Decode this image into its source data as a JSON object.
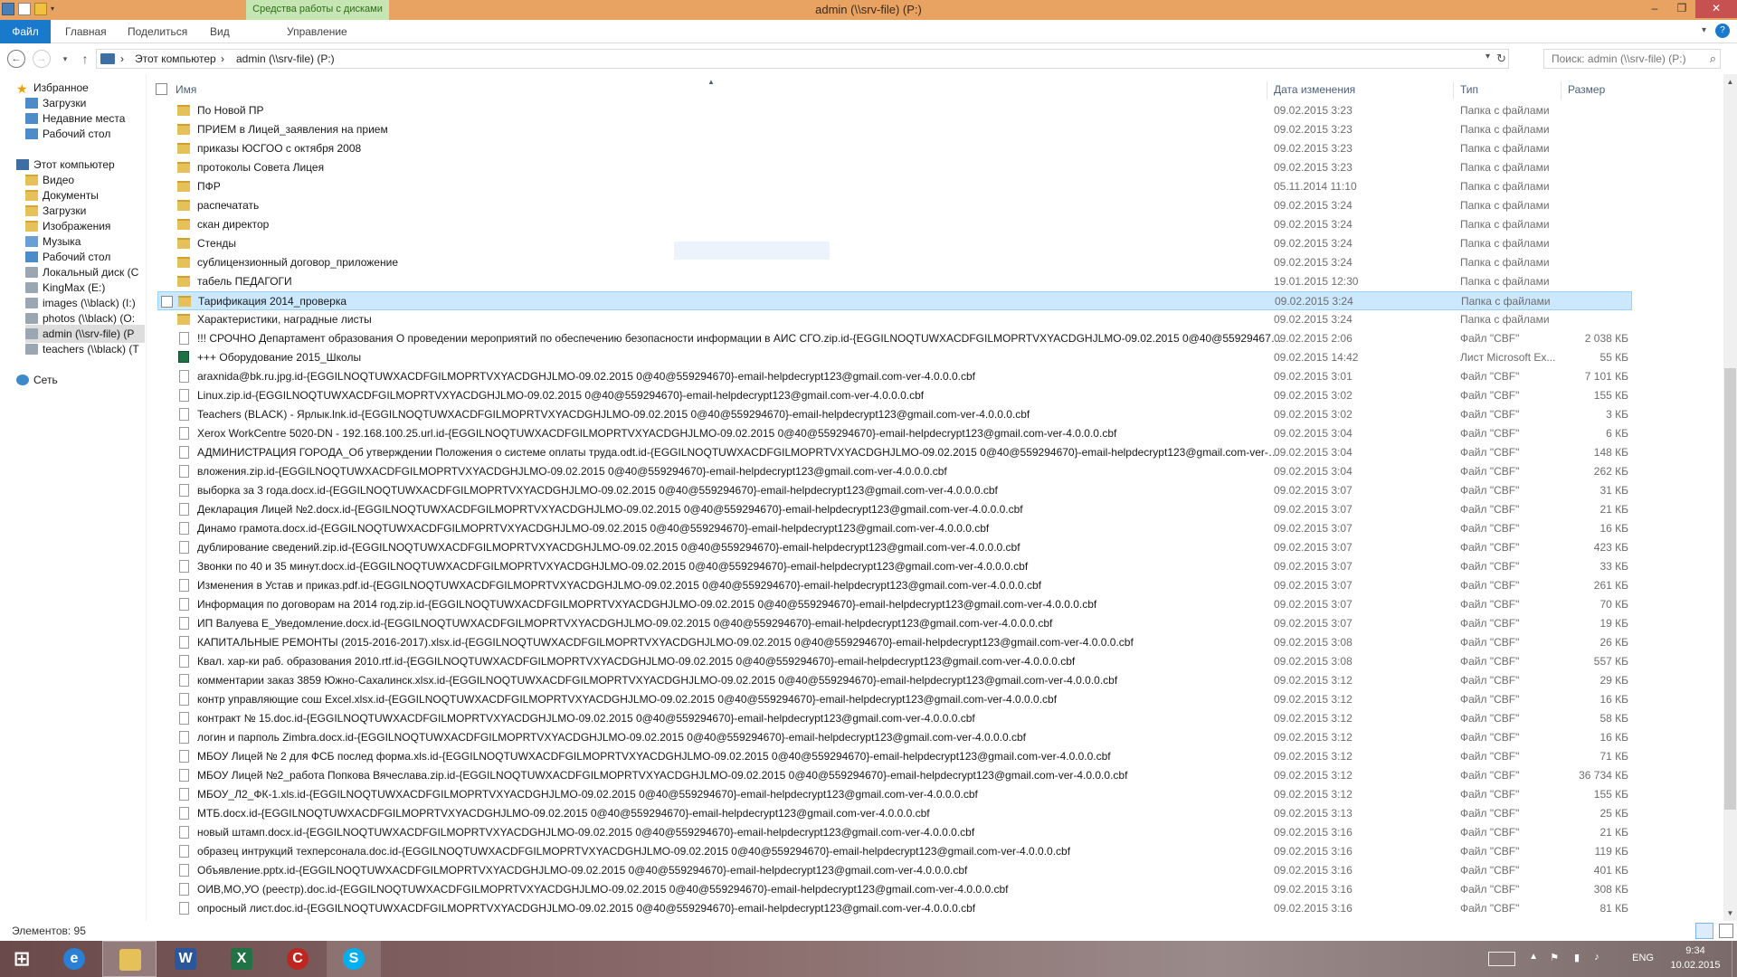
{
  "window": {
    "title": "admin (\\\\srv-file) (P:)",
    "context_tab": "Средства работы с дисками",
    "controls": {
      "minimize": "–",
      "maximize": "❐",
      "close": "✕"
    }
  },
  "ribbon": {
    "tabs": [
      "Файл",
      "Главная",
      "Поделиться",
      "Вид",
      "Управление"
    ]
  },
  "address": {
    "crumbs": [
      "Этот компьютер",
      "admin (\\\\srv-file) (P:)"
    ],
    "search_placeholder": "Поиск: admin (\\\\srv-file) (P:)"
  },
  "navpane": {
    "favorites": "Избранное",
    "fav_items": [
      "Загрузки",
      "Недавние места",
      "Рабочий стол"
    ],
    "computer": "Этот компьютер",
    "pc_items": [
      "Видео",
      "Документы",
      "Загрузки",
      "Изображения",
      "Музыка",
      "Рабочий стол",
      "Локальный диск (C",
      "KingMax (E:)",
      "images (\\\\black) (I:)",
      "photos (\\\\black) (O:",
      "admin (\\\\srv-file) (P",
      "teachers (\\\\black) (T"
    ],
    "network": "Сеть"
  },
  "columns": {
    "name": "Имя",
    "date": "Дата изменения",
    "type": "Тип",
    "size": "Размер"
  },
  "rows": [
    {
      "name": "По Новой ПР",
      "date": "09.02.2015 3:23",
      "type": "Папка с файлами",
      "size": "",
      "icon": "folder"
    },
    {
      "name": "ПРИЕМ в Лицей_заявления на прием",
      "date": "09.02.2015 3:23",
      "type": "Папка с файлами",
      "size": "",
      "icon": "folder"
    },
    {
      "name": "приказы ЮСГОО с октября 2008",
      "date": "09.02.2015 3:23",
      "type": "Папка с файлами",
      "size": "",
      "icon": "folder"
    },
    {
      "name": "протоколы Совета Лицея",
      "date": "09.02.2015 3:23",
      "type": "Папка с файлами",
      "size": "",
      "icon": "folder"
    },
    {
      "name": "ПФР",
      "date": "05.11.2014 11:10",
      "type": "Папка с файлами",
      "size": "",
      "icon": "folder"
    },
    {
      "name": "распечатать",
      "date": "09.02.2015 3:24",
      "type": "Папка с файлами",
      "size": "",
      "icon": "folder"
    },
    {
      "name": "скан директор",
      "date": "09.02.2015 3:24",
      "type": "Папка с файлами",
      "size": "",
      "icon": "folder"
    },
    {
      "name": "Стенды",
      "date": "09.02.2015 3:24",
      "type": "Папка с файлами",
      "size": "",
      "icon": "folder"
    },
    {
      "name": "сублицензионный договор_приложение",
      "date": "09.02.2015 3:24",
      "type": "Папка с файлами",
      "size": "",
      "icon": "folder"
    },
    {
      "name": "табель   ПЕДАГОГИ",
      "date": "19.01.2015 12:30",
      "type": "Папка с файлами",
      "size": "",
      "icon": "folder"
    },
    {
      "name": "Тарификация 2014_проверка",
      "date": "09.02.2015 3:24",
      "type": "Папка с файлами",
      "size": "",
      "icon": "folder",
      "selected": true
    },
    {
      "name": "Характеристики, наградные листы",
      "date": "09.02.2015 3:24",
      "type": "Папка с файлами",
      "size": "",
      "icon": "folder"
    },
    {
      "name": "!!! СРОЧНО Департамент образования О проведении мероприятий по обеспечению безопасности информации в АИС СГО.zip.id-{EGGILNOQTUWXACDFGILMOPRTVXYACDGHJLMO-09.02.2015 0@40@559294670}-e...",
      "date": "09.02.2015 2:06",
      "type": "Файл \"CBF\"",
      "size": "2 038 КБ",
      "icon": "file"
    },
    {
      "name": "+++ Оборудование  2015_Школы",
      "date": "09.02.2015 14:42",
      "type": "Лист Microsoft Ex...",
      "size": "55 КБ",
      "icon": "excel"
    },
    {
      "name": "araxnida@bk.ru.jpg.id-{EGGILNOQTUWXACDFGILMOPRTVXYACDGHJLMO-09.02.2015 0@40@559294670}-email-helpdecrypt123@gmail.com-ver-4.0.0.0.cbf",
      "date": "09.02.2015 3:01",
      "type": "Файл \"CBF\"",
      "size": "7 101 КБ",
      "icon": "file"
    },
    {
      "name": "Linux.zip.id-{EGGILNOQTUWXACDFGILMOPRTVXYACDGHJLMO-09.02.2015 0@40@559294670}-email-helpdecrypt123@gmail.com-ver-4.0.0.0.cbf",
      "date": "09.02.2015 3:02",
      "type": "Файл \"CBF\"",
      "size": "155 КБ",
      "icon": "file"
    },
    {
      "name": "Teachers (BLACK) - Ярлык.lnk.id-{EGGILNOQTUWXACDFGILMOPRTVXYACDGHJLMO-09.02.2015 0@40@559294670}-email-helpdecrypt123@gmail.com-ver-4.0.0.0.cbf",
      "date": "09.02.2015 3:02",
      "type": "Файл \"CBF\"",
      "size": "3 КБ",
      "icon": "file"
    },
    {
      "name": "Xerox WorkCentre 5020-DN - 192.168.100.25.url.id-{EGGILNOQTUWXACDFGILMOPRTVXYACDGHJLMO-09.02.2015 0@40@559294670}-email-helpdecrypt123@gmail.com-ver-4.0.0.0.cbf",
      "date": "09.02.2015 3:04",
      "type": "Файл \"CBF\"",
      "size": "6 КБ",
      "icon": "file"
    },
    {
      "name": "АДМИНИСТРАЦИЯ ГОРОДА_Об утверждении Положения о системе оплаты труда.odt.id-{EGGILNOQTUWXACDFGILMOPRTVXYACDGHJLMO-09.02.2015 0@40@559294670}-email-helpdecrypt123@gmail.com-ver-4.0.0....",
      "date": "09.02.2015 3:04",
      "type": "Файл \"CBF\"",
      "size": "148 КБ",
      "icon": "file"
    },
    {
      "name": "вложения.zip.id-{EGGILNOQTUWXACDFGILMOPRTVXYACDGHJLMO-09.02.2015 0@40@559294670}-email-helpdecrypt123@gmail.com-ver-4.0.0.0.cbf",
      "date": "09.02.2015 3:04",
      "type": "Файл \"CBF\"",
      "size": "262 КБ",
      "icon": "file"
    },
    {
      "name": "выборка за 3 года.docx.id-{EGGILNOQTUWXACDFGILMOPRTVXYACDGHJLMO-09.02.2015 0@40@559294670}-email-helpdecrypt123@gmail.com-ver-4.0.0.0.cbf",
      "date": "09.02.2015 3:07",
      "type": "Файл \"CBF\"",
      "size": "31 КБ",
      "icon": "file"
    },
    {
      "name": "Декларация Лицей №2.docx.id-{EGGILNOQTUWXACDFGILMOPRTVXYACDGHJLMO-09.02.2015 0@40@559294670}-email-helpdecrypt123@gmail.com-ver-4.0.0.0.cbf",
      "date": "09.02.2015 3:07",
      "type": "Файл \"CBF\"",
      "size": "21 КБ",
      "icon": "file"
    },
    {
      "name": "Динамо грамота.docx.id-{EGGILNOQTUWXACDFGILMOPRTVXYACDGHJLMO-09.02.2015 0@40@559294670}-email-helpdecrypt123@gmail.com-ver-4.0.0.0.cbf",
      "date": "09.02.2015 3:07",
      "type": "Файл \"CBF\"",
      "size": "16 КБ",
      "icon": "file"
    },
    {
      "name": "дублирование сведений.zip.id-{EGGILNOQTUWXACDFGILMOPRTVXYACDGHJLMO-09.02.2015 0@40@559294670}-email-helpdecrypt123@gmail.com-ver-4.0.0.0.cbf",
      "date": "09.02.2015 3:07",
      "type": "Файл \"CBF\"",
      "size": "423 КБ",
      "icon": "file"
    },
    {
      "name": "Звонки по 40 и 35 минут.docx.id-{EGGILNOQTUWXACDFGILMOPRTVXYACDGHJLMO-09.02.2015 0@40@559294670}-email-helpdecrypt123@gmail.com-ver-4.0.0.0.cbf",
      "date": "09.02.2015 3:07",
      "type": "Файл \"CBF\"",
      "size": "33 КБ",
      "icon": "file"
    },
    {
      "name": "Изменения в Устав и приказ.pdf.id-{EGGILNOQTUWXACDFGILMOPRTVXYACDGHJLMO-09.02.2015 0@40@559294670}-email-helpdecrypt123@gmail.com-ver-4.0.0.0.cbf",
      "date": "09.02.2015 3:07",
      "type": "Файл \"CBF\"",
      "size": "261 КБ",
      "icon": "file"
    },
    {
      "name": "Информация по договорам на 2014 год.zip.id-{EGGILNOQTUWXACDFGILMOPRTVXYACDGHJLMO-09.02.2015 0@40@559294670}-email-helpdecrypt123@gmail.com-ver-4.0.0.0.cbf",
      "date": "09.02.2015 3:07",
      "type": "Файл \"CBF\"",
      "size": "70 КБ",
      "icon": "file"
    },
    {
      "name": "ИП Валуева Е_Уведомление.docx.id-{EGGILNOQTUWXACDFGILMOPRTVXYACDGHJLMO-09.02.2015 0@40@559294670}-email-helpdecrypt123@gmail.com-ver-4.0.0.0.cbf",
      "date": "09.02.2015 3:07",
      "type": "Файл \"CBF\"",
      "size": "19 КБ",
      "icon": "file"
    },
    {
      "name": "КАПИТАЛЬНЫЕ РЕМОНТЫ (2015-2016-2017).xlsx.id-{EGGILNOQTUWXACDFGILMOPRTVXYACDGHJLMO-09.02.2015 0@40@559294670}-email-helpdecrypt123@gmail.com-ver-4.0.0.0.cbf",
      "date": "09.02.2015 3:08",
      "type": "Файл \"CBF\"",
      "size": "26 КБ",
      "icon": "file"
    },
    {
      "name": "Квал. хар-ки раб. образования 2010.rtf.id-{EGGILNOQTUWXACDFGILMOPRTVXYACDGHJLMO-09.02.2015 0@40@559294670}-email-helpdecrypt123@gmail.com-ver-4.0.0.0.cbf",
      "date": "09.02.2015 3:08",
      "type": "Файл \"CBF\"",
      "size": "557 КБ",
      "icon": "file"
    },
    {
      "name": "комментарии заказ 3859 Южно-Сахалинск.xlsx.id-{EGGILNOQTUWXACDFGILMOPRTVXYACDGHJLMO-09.02.2015 0@40@559294670}-email-helpdecrypt123@gmail.com-ver-4.0.0.0.cbf",
      "date": "09.02.2015 3:12",
      "type": "Файл \"CBF\"",
      "size": "29 КБ",
      "icon": "file"
    },
    {
      "name": "контр управляющие сош Excel.xlsx.id-{EGGILNOQTUWXACDFGILMOPRTVXYACDGHJLMO-09.02.2015 0@40@559294670}-email-helpdecrypt123@gmail.com-ver-4.0.0.0.cbf",
      "date": "09.02.2015 3:12",
      "type": "Файл \"CBF\"",
      "size": "16 КБ",
      "icon": "file"
    },
    {
      "name": "контракт № 15.doc.id-{EGGILNOQTUWXACDFGILMOPRTVXYACDGHJLMO-09.02.2015 0@40@559294670}-email-helpdecrypt123@gmail.com-ver-4.0.0.0.cbf",
      "date": "09.02.2015 3:12",
      "type": "Файл \"CBF\"",
      "size": "58 КБ",
      "icon": "file"
    },
    {
      "name": "логин и парполь Zimbra.docx.id-{EGGILNOQTUWXACDFGILMOPRTVXYACDGHJLMO-09.02.2015 0@40@559294670}-email-helpdecrypt123@gmail.com-ver-4.0.0.0.cbf",
      "date": "09.02.2015 3:12",
      "type": "Файл \"CBF\"",
      "size": "16 КБ",
      "icon": "file"
    },
    {
      "name": "МБОУ Лицей  № 2 для  ФСБ послед форма.xls.id-{EGGILNOQTUWXACDFGILMOPRTVXYACDGHJLMO-09.02.2015 0@40@559294670}-email-helpdecrypt123@gmail.com-ver-4.0.0.0.cbf",
      "date": "09.02.2015 3:12",
      "type": "Файл \"CBF\"",
      "size": "71 КБ",
      "icon": "file"
    },
    {
      "name": "МБОУ Лицей №2_работа Попкова Вячеслава.zip.id-{EGGILNOQTUWXACDFGILMOPRTVXYACDGHJLMO-09.02.2015 0@40@559294670}-email-helpdecrypt123@gmail.com-ver-4.0.0.0.cbf",
      "date": "09.02.2015 3:12",
      "type": "Файл \"CBF\"",
      "size": "36 734 КБ",
      "icon": "file"
    },
    {
      "name": "МБОУ_Л2_ФК-1.xls.id-{EGGILNOQTUWXACDFGILMOPRTVXYACDGHJLMO-09.02.2015 0@40@559294670}-email-helpdecrypt123@gmail.com-ver-4.0.0.0.cbf",
      "date": "09.02.2015 3:12",
      "type": "Файл \"CBF\"",
      "size": "155 КБ",
      "icon": "file"
    },
    {
      "name": "МТБ.docx.id-{EGGILNOQTUWXACDFGILMOPRTVXYACDGHJLMO-09.02.2015 0@40@559294670}-email-helpdecrypt123@gmail.com-ver-4.0.0.0.cbf",
      "date": "09.02.2015 3:13",
      "type": "Файл \"CBF\"",
      "size": "25 КБ",
      "icon": "file"
    },
    {
      "name": "новый штамп.docx.id-{EGGILNOQTUWXACDFGILMOPRTVXYACDGHJLMO-09.02.2015 0@40@559294670}-email-helpdecrypt123@gmail.com-ver-4.0.0.0.cbf",
      "date": "09.02.2015 3:16",
      "type": "Файл \"CBF\"",
      "size": "21 КБ",
      "icon": "file"
    },
    {
      "name": "образец интрукций техперсонала.doc.id-{EGGILNOQTUWXACDFGILMOPRTVXYACDGHJLMO-09.02.2015 0@40@559294670}-email-helpdecrypt123@gmail.com-ver-4.0.0.0.cbf",
      "date": "09.02.2015 3:16",
      "type": "Файл \"CBF\"",
      "size": "119 КБ",
      "icon": "file"
    },
    {
      "name": "Объявление.pptx.id-{EGGILNOQTUWXACDFGILMOPRTVXYACDGHJLMO-09.02.2015 0@40@559294670}-email-helpdecrypt123@gmail.com-ver-4.0.0.0.cbf",
      "date": "09.02.2015 3:16",
      "type": "Файл \"CBF\"",
      "size": "401 КБ",
      "icon": "file"
    },
    {
      "name": "ОИВ,МО,УО (реестр).doc.id-{EGGILNOQTUWXACDFGILMOPRTVXYACDGHJLMO-09.02.2015 0@40@559294670}-email-helpdecrypt123@gmail.com-ver-4.0.0.0.cbf",
      "date": "09.02.2015 3:16",
      "type": "Файл \"CBF\"",
      "size": "308 КБ",
      "icon": "file"
    },
    {
      "name": "опросный лист.doc.id-{EGGILNOQTUWXACDFGILMOPRTVXYACDGHJLMO-09.02.2015 0@40@559294670}-email-helpdecrypt123@gmail.com-ver-4.0.0.0.cbf",
      "date": "09.02.2015 3:16",
      "type": "Файл \"CBF\"",
      "size": "81 КБ",
      "icon": "file"
    }
  ],
  "status": {
    "count": "Элементов: 95"
  },
  "taskbar": {
    "apps": [
      "Internet Explorer",
      "Проводник",
      "Word",
      "Excel",
      "App",
      "Skype"
    ],
    "lang": "ENG",
    "time": "9:34",
    "date": "10.02.2015"
  }
}
